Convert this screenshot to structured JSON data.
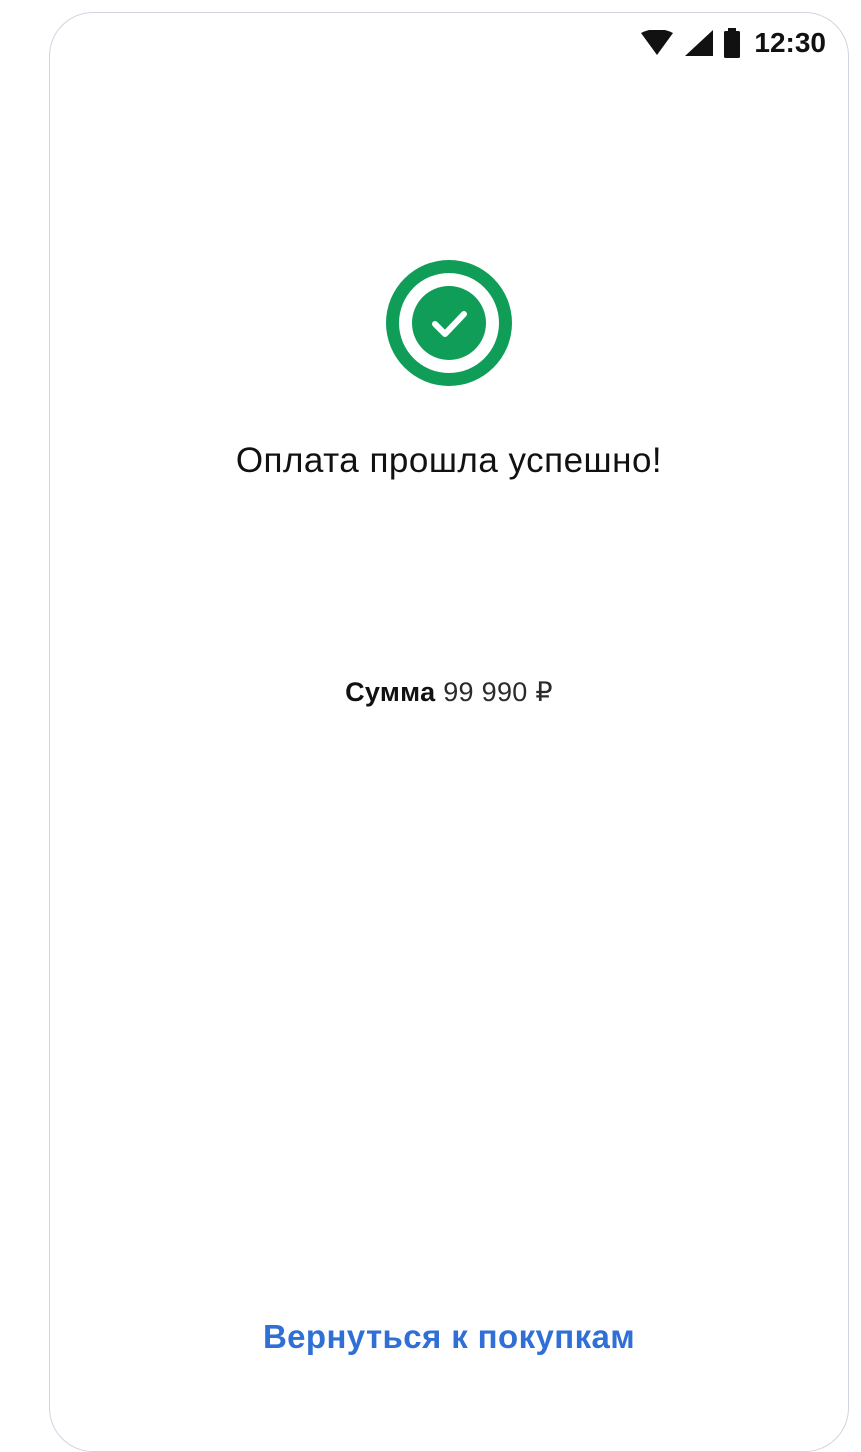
{
  "status_bar": {
    "time": "12:30",
    "icons": [
      "wifi-icon",
      "cellular-signal-icon",
      "battery-icon"
    ]
  },
  "result": {
    "icon": "check-circle-icon",
    "title": "Оплата прошла успешно!",
    "amount_label": "Сумма",
    "amount_value": "99 990 ₽"
  },
  "actions": {
    "back_link_label": "Вернуться к покупкам"
  },
  "colors": {
    "success_green": "#0f9d58",
    "link_blue": "#2f6fd6",
    "text": "#111111"
  }
}
